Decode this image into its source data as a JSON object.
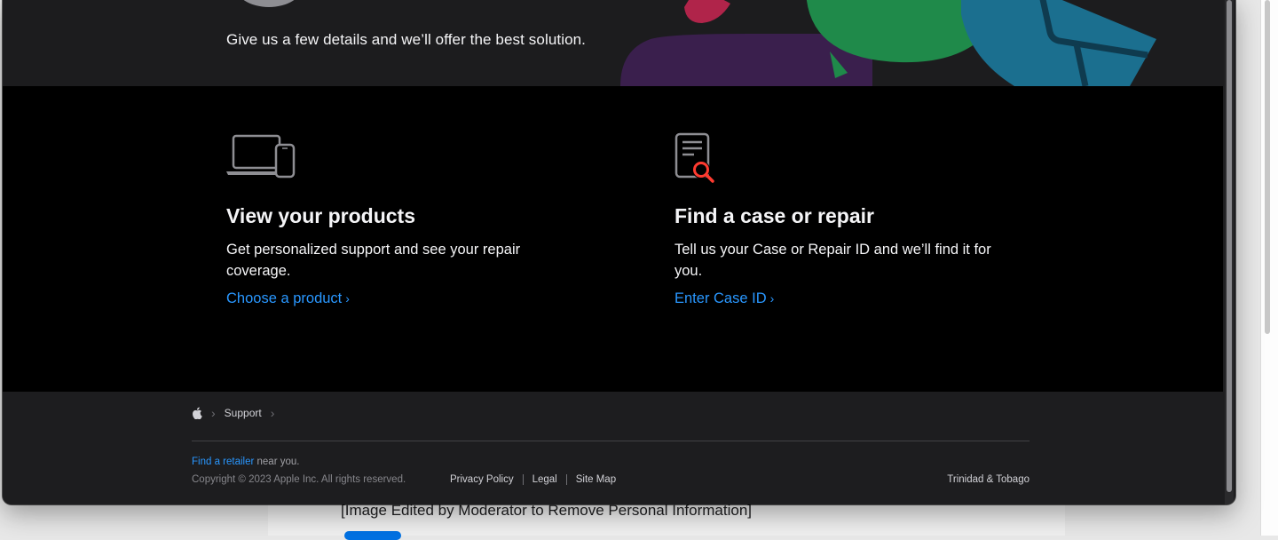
{
  "hero": {
    "subtitle": "Give us a few details and we’ll offer the best solution."
  },
  "cards": [
    {
      "icon": "laptop-phone-icon",
      "title": "View your products",
      "description": "Get personalized support and see your repair coverage.",
      "link_label": "Choose a product",
      "link_chevron": "›"
    },
    {
      "icon": "document-search-icon",
      "title": "Find a case or repair",
      "description": "Tell us your Case or Repair ID and we’ll find it for you.",
      "link_label": "Enter Case ID",
      "link_chevron": "›"
    }
  ],
  "footer": {
    "breadcrumbs": [
      "Support"
    ],
    "retailer_link": "Find a retailer",
    "retailer_suffix": " near you.",
    "copyright": "Copyright © 2023 Apple Inc. All rights reserved.",
    "links": [
      "Privacy Policy",
      "Legal",
      "Site Map"
    ],
    "region": "Trinidad & Tobago"
  },
  "background_page": {
    "notice": "[Image Edited by Moderator to Remove Personal Information]"
  },
  "colors": {
    "link": "#2997ff",
    "hero_bg": "#1c1c1e",
    "main_bg": "#000000",
    "footer_bg": "#1d1d1f",
    "search_accent": "#ff3b30"
  }
}
